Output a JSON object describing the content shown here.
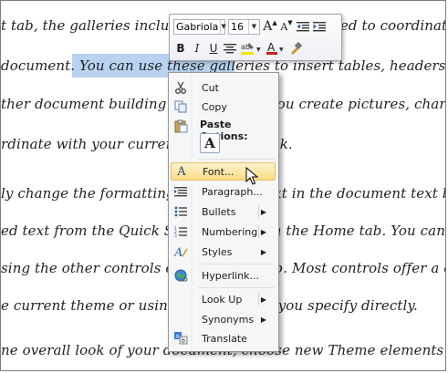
{
  "document": {
    "lines": [
      "t tab, the galleries include items that are designed to coordinate with the ov",
      "document. You can use these galleries to insert tables, headers, footers, lists",
      "ther document building blocks. When you create pictures, charts, or diagra",
      "rdinate with your current document look.",
      "ly change the formatting of selected text in the document text by choosing",
      "ed text from the Quick Styles gallery on the Home tab. You can also format",
      "sing the other controls on the Home tab. Most controls offer a choice of usi",
      "e current theme or using a format that you specify directly.",
      "ne overall look of your document, choose new Theme elements on the Page L"
    ]
  },
  "mini_toolbar": {
    "font_name": "Gabriola",
    "font_size": "16",
    "grow_font": "A",
    "shrink_font": "A",
    "bold": "B",
    "italic": "I",
    "underline": "U",
    "font_color_glyph": "A",
    "highlight_color": "#f2e600",
    "font_color": "#d01c1c"
  },
  "context_menu": {
    "cut": "Cut",
    "copy": "Copy",
    "paste_options_header": "Paste Options:",
    "paste_keep_text": "A",
    "font": "Font...",
    "paragraph": "Paragraph...",
    "bullets": "Bullets",
    "numbering": "Numbering",
    "styles": "Styles",
    "hyperlink": "Hyperlink...",
    "look_up": "Look Up",
    "synonyms": "Synonyms",
    "translate": "Translate",
    "submenu_arrow": "▶"
  },
  "colors": {
    "selection": "#b8d2f0",
    "menu_hover": "#fbdc85"
  }
}
